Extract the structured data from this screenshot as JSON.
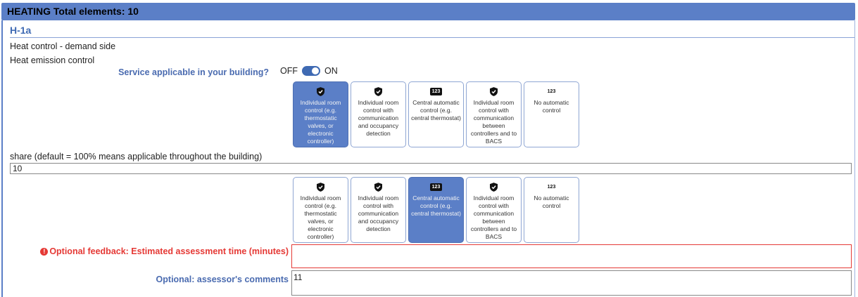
{
  "header": {
    "title": "HEATING Total elements: 10"
  },
  "element": {
    "code": "H-1a",
    "line1": "Heat control - demand side",
    "line2": "Heat emission control"
  },
  "service": {
    "label": "Service applicable in your building?",
    "off": "OFF",
    "on": "ON",
    "state": "on"
  },
  "options_row1": [
    {
      "label": "Individual room control (e.g. thermostatic valves, or electronic controller)",
      "icon": "shield-check-icon",
      "selected": true
    },
    {
      "label": "Individual room control with communication and occupancy detection",
      "icon": "shield-check-icon",
      "selected": false
    },
    {
      "label": "Central automatic control (e.g. central thermostat)",
      "icon": "123-badge-icon",
      "selected": false
    },
    {
      "label": "Individual room control with communication between controllers and to BACS",
      "icon": "shield-check-icon",
      "selected": false
    },
    {
      "label": "No automatic control",
      "icon": "123-text-icon",
      "selected": false
    }
  ],
  "share": {
    "label": "share (default = 100% means applicable throughout the building)",
    "value": "10"
  },
  "options_row2": [
    {
      "label": "Individual room control (e.g. thermostatic valves, or electronic controller)",
      "icon": "shield-check-icon",
      "selected": false
    },
    {
      "label": "Individual room control with communication and occupancy detection",
      "icon": "shield-check-icon",
      "selected": false
    },
    {
      "label": "Central automatic control (e.g. central thermostat)",
      "icon": "123-badge-icon",
      "selected": true
    },
    {
      "label": "Individual room control with communication between controllers and to BACS",
      "icon": "shield-check-icon",
      "selected": false
    },
    {
      "label": "No automatic control",
      "icon": "123-text-icon",
      "selected": false
    }
  ],
  "badge_text": "123",
  "feedback": {
    "label": "Optional feedback: Estimated assessment time (minutes)",
    "value": ""
  },
  "comments": {
    "label": "Optional: assessor's comments",
    "value": "11"
  },
  "colors": {
    "accent": "#5b7fc7",
    "label_blue": "#4a6bb0",
    "error": "#e53935"
  }
}
